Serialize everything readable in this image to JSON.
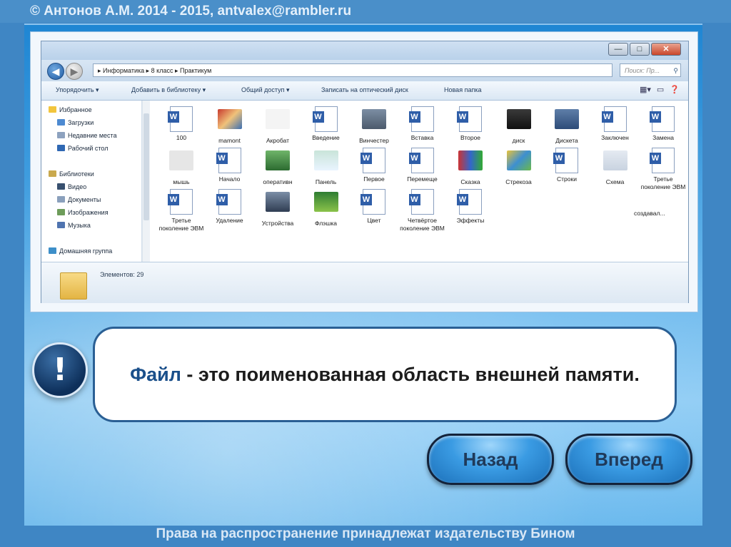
{
  "header": {
    "text": "© Антонов А.М. 2014 - 2015, antvalex@rambler.ru"
  },
  "footer": {
    "text": "Права на распространение принадлежат издательству Бином"
  },
  "explorer": {
    "window_buttons": {
      "minimize": "—",
      "maximize": "□",
      "close": "✕"
    },
    "breadcrumb": "▸ Информатика ▸ 8 класс ▸ Практикум",
    "search_placeholder": "Поиск: Пр...",
    "toolbar": {
      "organize": "Упорядочить ▾",
      "add_library": "Добавить в библиотеку ▾",
      "share": "Общий доступ ▾",
      "burn": "Записать на оптический диск",
      "new_folder": "Новая папка"
    },
    "sidebar": {
      "favorites": "Избранное",
      "downloads": "Загрузки",
      "recent": "Недавние места",
      "desktop": "Рабочий стол",
      "libraries": "Библиотеки",
      "video": "Видео",
      "documents": "Документы",
      "images": "Изображения",
      "music": "Музыка",
      "homegroup": "Домашняя группа"
    },
    "files": [
      "100",
      "mamont",
      "Акробат",
      "Введение",
      "Винчестер",
      "Вставка",
      "Второе",
      "диск",
      "Дискета",
      "Заключен",
      "Замена",
      "мышь",
      "Начало",
      "оперативн",
      "Панель",
      "Первое",
      "Перемеще",
      "Сказка",
      "Стрекоза",
      "Строки",
      "Схема",
      "Третье поколение ЭВМ",
      "Третье поколение ЭВМ",
      "Удаление",
      "Устройства",
      "Флэшка",
      "Цвет",
      "Четвёртое поколение ЭВМ",
      "Эффекты"
    ],
    "extra_label": "создавал...",
    "status": "Элементов: 29"
  },
  "definition": {
    "mark": "!",
    "term": "Файл",
    "rest": " - это поименованная область внешней памяти."
  },
  "buttons": {
    "back": "Назад",
    "forward": "Вперед"
  }
}
